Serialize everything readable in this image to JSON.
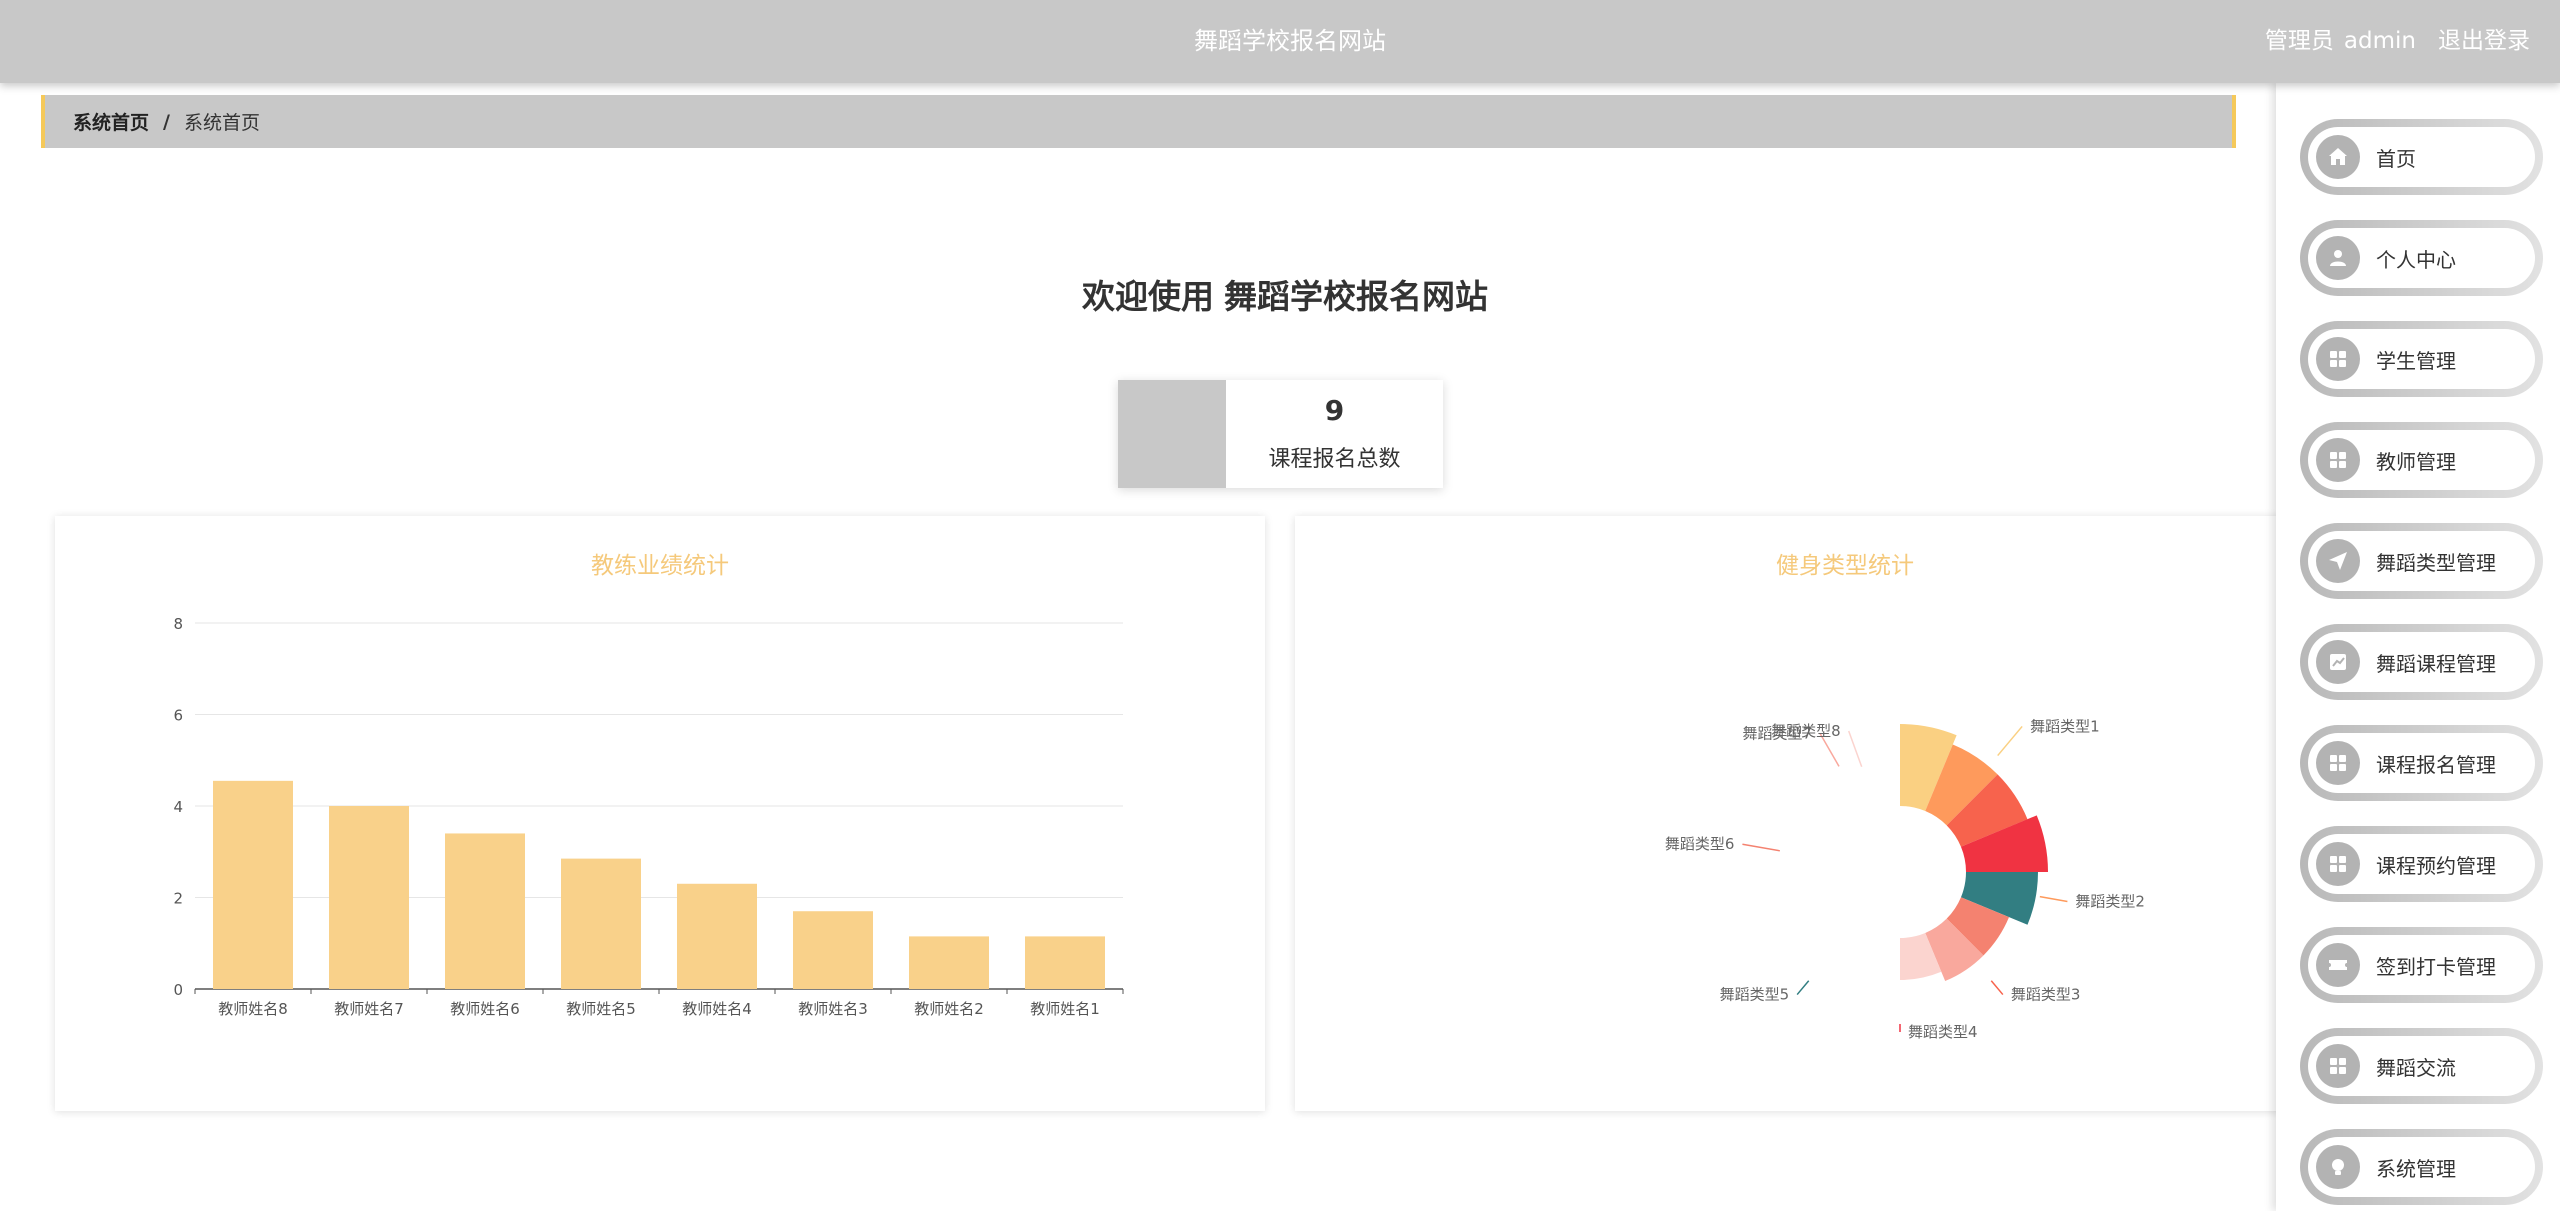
{
  "header": {
    "title": "舞蹈学校报名网站",
    "role": "管理员",
    "username": "admin",
    "logout": "退出登录"
  },
  "breadcrumb": {
    "home": "系统首页",
    "separator": "/",
    "current": "系统首页"
  },
  "welcome": {
    "prefix": "欢迎使用",
    "site_name": "舞蹈学校报名网站"
  },
  "stat": {
    "value": "9",
    "label": "课程报名总数"
  },
  "sidebar": {
    "items": [
      {
        "label": "首页",
        "icon": "home-icon"
      },
      {
        "label": "个人中心",
        "icon": "user-icon"
      },
      {
        "label": "学生管理",
        "icon": "grid-icon"
      },
      {
        "label": "教师管理",
        "icon": "grid-icon"
      },
      {
        "label": "舞蹈类型管理",
        "icon": "send-icon"
      },
      {
        "label": "舞蹈课程管理",
        "icon": "chart-icon"
      },
      {
        "label": "课程报名管理",
        "icon": "grid-icon"
      },
      {
        "label": "课程预约管理",
        "icon": "grid-icon"
      },
      {
        "label": "签到打卡管理",
        "icon": "ticket-icon"
      },
      {
        "label": "舞蹈交流",
        "icon": "grid-icon"
      },
      {
        "label": "系统管理",
        "icon": "bulb-icon"
      }
    ]
  },
  "chart_data": [
    {
      "type": "bar",
      "title": "教练业绩统计",
      "categories": [
        "教师姓名8",
        "教师姓名7",
        "教师姓名6",
        "教师姓名5",
        "教师姓名4",
        "教师姓名3",
        "教师姓名2",
        "教师姓名1"
      ],
      "values": [
        4.55,
        4.0,
        3.4,
        2.85,
        2.3,
        1.7,
        1.15,
        1.15
      ],
      "ylim": [
        0,
        8
      ],
      "yticks": [
        "0",
        "2",
        "4",
        "6",
        "8"
      ],
      "grid": true,
      "color": "#f9d18a"
    },
    {
      "type": "pie",
      "title": "健身类型统计",
      "style": "nightingale-rose",
      "labels": [
        "舞蹈类型1",
        "舞蹈类型2",
        "舞蹈类型3",
        "舞蹈类型4",
        "舞蹈类型5",
        "舞蹈类型6",
        "舞蹈类型7",
        "舞蹈类型8"
      ],
      "segment_colors": [
        "#fad082",
        "#fe9a5c",
        "#f7634d",
        "#f03342",
        "#327e82",
        "#f48270",
        "#f9a89d",
        "#fbd4cf"
      ],
      "radii": [
        148,
        138,
        138,
        148,
        138,
        118,
        118,
        108
      ]
    }
  ]
}
